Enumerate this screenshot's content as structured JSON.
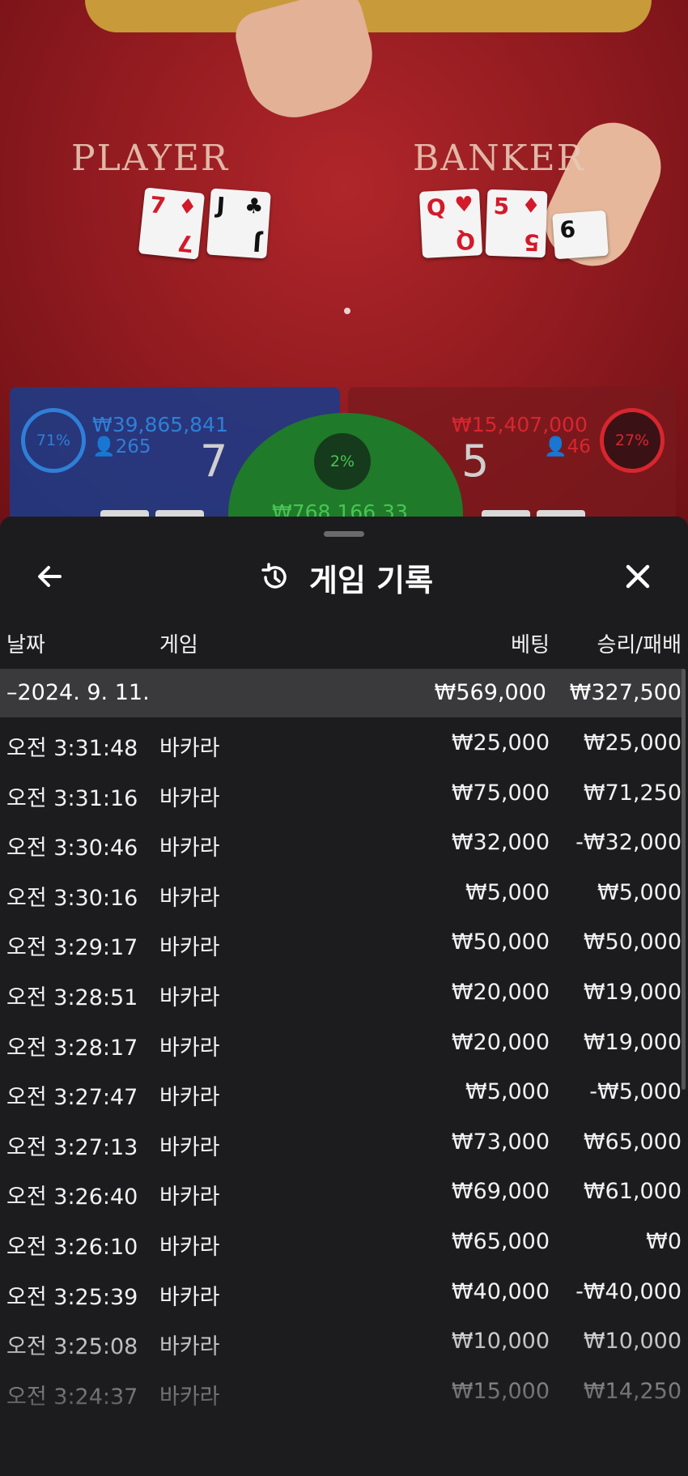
{
  "video": {
    "player_label": "PLAYER",
    "banker_label": "BANKER",
    "player_cards": [
      {
        "rank": "7",
        "suit": "♦",
        "color": "red"
      },
      {
        "rank": "J",
        "suit": "♣",
        "color": "black"
      }
    ],
    "banker_cards": [
      {
        "rank": "Q",
        "suit": "♥",
        "color": "red"
      },
      {
        "rank": "5",
        "suit": "♦",
        "color": "red"
      },
      {
        "rank": "6",
        "suit": "",
        "color": "black"
      }
    ],
    "player_panel": {
      "percent": "71%",
      "amount": "₩39,865,841",
      "count": "265",
      "score": "7"
    },
    "banker_panel": {
      "percent": "27%",
      "amount": "₩15,407,000",
      "count": "46",
      "score": "5"
    },
    "tie_panel": {
      "percent": "2%",
      "amount": "₩768,166.33"
    }
  },
  "history": {
    "title": "게임 기록",
    "columns": {
      "date": "날짜",
      "game": "게임",
      "bet": "베팅",
      "win_loss": "승리/패배"
    },
    "group": {
      "date": "–2024. 9. 11.",
      "bet_total": "₩569,000",
      "win_total": "₩327,500"
    },
    "rows": [
      {
        "time": "오전 3:31:48",
        "game": "바카라",
        "bet": "₩25,000",
        "win": "₩25,000"
      },
      {
        "time": "오전 3:31:16",
        "game": "바카라",
        "bet": "₩75,000",
        "win": "₩71,250"
      },
      {
        "time": "오전 3:30:46",
        "game": "바카라",
        "bet": "₩32,000",
        "win": "-₩32,000"
      },
      {
        "time": "오전 3:30:16",
        "game": "바카라",
        "bet": "₩5,000",
        "win": "₩5,000"
      },
      {
        "time": "오전 3:29:17",
        "game": "바카라",
        "bet": "₩50,000",
        "win": "₩50,000"
      },
      {
        "time": "오전 3:28:51",
        "game": "바카라",
        "bet": "₩20,000",
        "win": "₩19,000"
      },
      {
        "time": "오전 3:28:17",
        "game": "바카라",
        "bet": "₩20,000",
        "win": "₩19,000"
      },
      {
        "time": "오전 3:27:47",
        "game": "바카라",
        "bet": "₩5,000",
        "win": "-₩5,000"
      },
      {
        "time": "오전 3:27:13",
        "game": "바카라",
        "bet": "₩73,000",
        "win": "₩65,000"
      },
      {
        "time": "오전 3:26:40",
        "game": "바카라",
        "bet": "₩69,000",
        "win": "₩61,000"
      },
      {
        "time": "오전 3:26:10",
        "game": "바카라",
        "bet": "₩65,000",
        "win": "₩0"
      },
      {
        "time": "오전 3:25:39",
        "game": "바카라",
        "bet": "₩40,000",
        "win": "-₩40,000"
      },
      {
        "time": "오전 3:25:08",
        "game": "바카라",
        "bet": "₩10,000",
        "win": "₩10,000"
      },
      {
        "time": "오전 3:24:37",
        "game": "바카라",
        "bet": "₩15,000",
        "win": "₩14,250"
      }
    ]
  },
  "colors": {
    "player_blue": "#2f7fd8",
    "banker_red": "#d8262e",
    "tie_green": "#49c553",
    "sheet_bg": "#1c1c1e",
    "group_bg": "#3a3a3c"
  },
  "icons": {
    "back": "arrow-left-icon",
    "history": "history-clock-icon",
    "close": "close-icon"
  }
}
